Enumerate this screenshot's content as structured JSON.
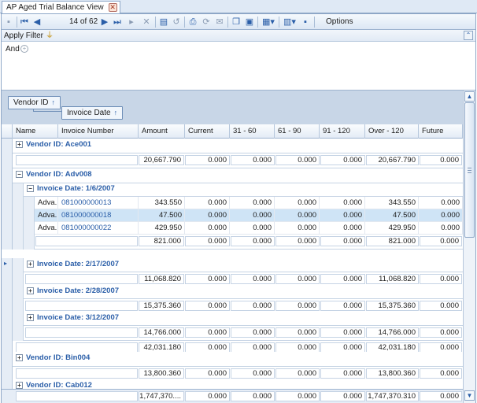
{
  "window": {
    "tab_title": "AP Aged Trial Balance View",
    "tab_close": "✕"
  },
  "toolbar": {
    "page_position": "14 of 62",
    "options_label": "Options"
  },
  "filter": {
    "title": "Apply Filter",
    "and_label": "And",
    "add_symbol": "+"
  },
  "grouping": {
    "chips": [
      {
        "label": "Vendor ID",
        "arrow": "↑"
      },
      {
        "label": "Invoice Date",
        "arrow": "↑"
      }
    ]
  },
  "columns": [
    "Name",
    "Invoice Number",
    "Amount",
    "Current",
    "31 - 60",
    "61 - 90",
    "91 - 120",
    "Over - 120",
    "Future"
  ],
  "groups": {
    "ace001": {
      "title": "Vendor ID: Ace001",
      "summary": [
        "20,667.790",
        "0.000",
        "0.000",
        "0.000",
        "0.000",
        "20,667.790",
        "0.000"
      ]
    },
    "adv008": {
      "title": "Vendor ID: Adv008",
      "date1": {
        "title": "Invoice Date: 1/6/2007",
        "rows": [
          {
            "name": "Adva...",
            "invoice": "081000000013",
            "values": [
              "343.550",
              "0.000",
              "0.000",
              "0.000",
              "0.000",
              "343.550",
              "0.000"
            ]
          },
          {
            "name": "Adva...",
            "invoice": "081000000018",
            "values": [
              "47.500",
              "0.000",
              "0.000",
              "0.000",
              "0.000",
              "47.500",
              "0.000"
            ]
          },
          {
            "name": "Adva...",
            "invoice": "081000000022",
            "values": [
              "429.950",
              "0.000",
              "0.000",
              "0.000",
              "0.000",
              "429.950",
              "0.000"
            ]
          }
        ],
        "summary": [
          "821.000",
          "0.000",
          "0.000",
          "0.000",
          "0.000",
          "821.000",
          "0.000"
        ]
      },
      "date2": {
        "title": "Invoice Date: 2/17/2007",
        "summary": [
          "11,068.820",
          "0.000",
          "0.000",
          "0.000",
          "0.000",
          "11,068.820",
          "0.000"
        ]
      },
      "date3": {
        "title": "Invoice Date: 2/28/2007",
        "summary": [
          "15,375.360",
          "0.000",
          "0.000",
          "0.000",
          "0.000",
          "15,375.360",
          "0.000"
        ]
      },
      "date4": {
        "title": "Invoice Date: 3/12/2007",
        "summary": [
          "14,766.000",
          "0.000",
          "0.000",
          "0.000",
          "0.000",
          "14,766.000",
          "0.000"
        ]
      },
      "summary": [
        "42,031.180",
        "0.000",
        "0.000",
        "0.000",
        "0.000",
        "42,031.180",
        "0.000"
      ]
    },
    "bin004": {
      "title": "Vendor ID: Bin004",
      "summary": [
        "13,800.360",
        "0.000",
        "0.000",
        "0.000",
        "0.000",
        "13,800.360",
        "0.000"
      ]
    },
    "cab012": {
      "title": "Vendor ID: Cab012"
    }
  },
  "grand_total": [
    "1,747,370....",
    "0.000",
    "0.000",
    "0.000",
    "0.000",
    "1,747,370.310",
    "0.000"
  ],
  "symbols": {
    "expand": "+",
    "collapse": "−",
    "scroll_up": "▲",
    "scroll_down": "▼",
    "collapse_panel": "⌃"
  }
}
